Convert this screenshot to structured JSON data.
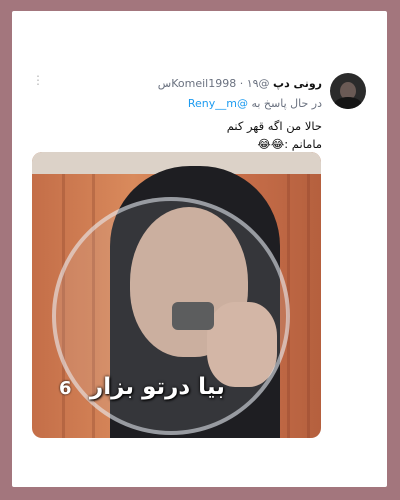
{
  "tweet": {
    "display_name": "رونی دپ",
    "handle": "@Komeil1998",
    "separator": "·",
    "timestamp": "۱۹س",
    "reply_prefix": "در حال پاسخ به",
    "reply_to": "@Reny__m",
    "text_line1": "حالا من اگه قهر کنم",
    "text_line2": "مامانم :😂😂",
    "more_icon": "⋮"
  },
  "media": {
    "caption": "بیا درتو بزار",
    "logo_glyph": "6"
  },
  "colors": {
    "background": "#a3767d",
    "card": "#ffffff",
    "mention": "#1d9bf0",
    "secondary_text": "#6b7280"
  }
}
